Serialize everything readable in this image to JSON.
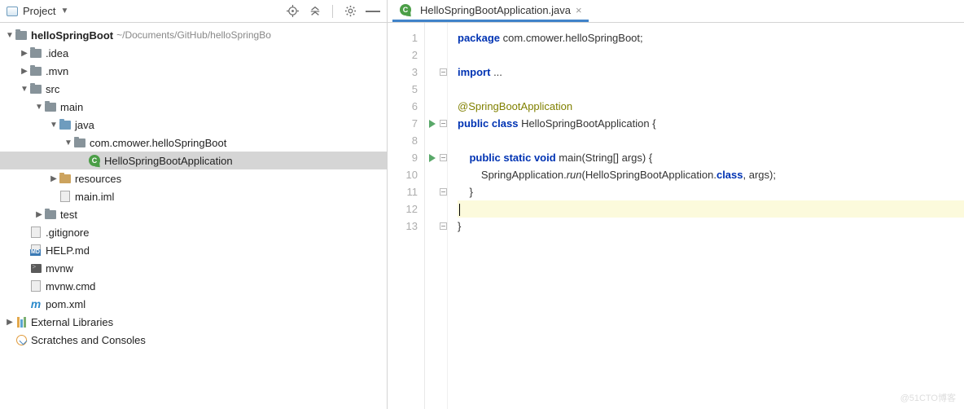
{
  "toolbar": {
    "title": "Project"
  },
  "tree": {
    "root": {
      "name": "helloSpringBoot",
      "path": "~/Documents/GitHub/helloSpringBo"
    },
    "items": [
      ".idea",
      ".mvn",
      "src",
      "main",
      "java",
      "com.cmower.helloSpringBoot",
      "HelloSpringBootApplication",
      "resources",
      "main.iml",
      "test",
      ".gitignore",
      "HELP.md",
      "mvnw",
      "mvnw.cmd",
      "pom.xml",
      "External Libraries",
      "Scratches and Consoles"
    ]
  },
  "tab": {
    "name": "HelloSpringBootApplication.java"
  },
  "code": {
    "lines": [
      "1",
      "2",
      "3",
      "5",
      "6",
      "7",
      "8",
      "9",
      "10",
      "11",
      "12",
      "13"
    ],
    "l1a": "package",
    "l1b": " com.cmower.helloSpringBoot;",
    "l3a": "import",
    "l3b": " ...",
    "l6": "@SpringBootApplication",
    "l7a": "public",
    "l7b": "class",
    "l7c": " HelloSpringBootApplication {",
    "l9a": "public",
    "l9b": "static",
    "l9c": "void",
    "l9d": " main(String[] args) {",
    "l10a": "        SpringApplication.",
    "l10b": "run",
    "l10c": "(HelloSpringBootApplication.",
    "l10d": "class",
    "l10e": ", args);",
    "l11": "    }",
    "l13": "}"
  },
  "watermark": "@51CTO博客"
}
